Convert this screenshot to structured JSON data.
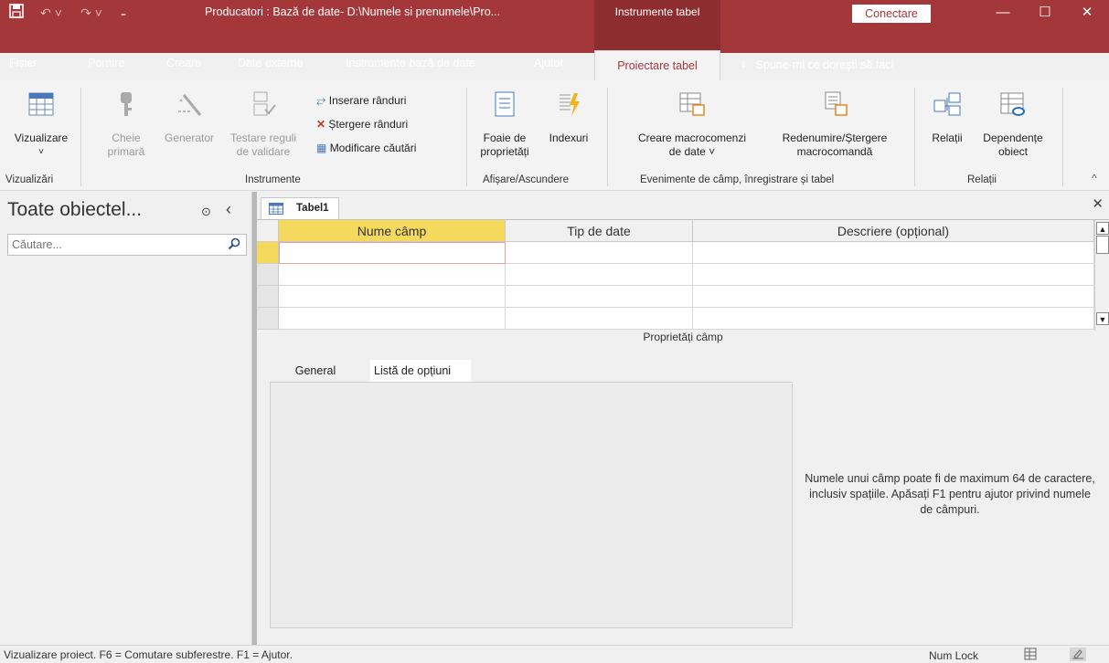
{
  "titlebar": {
    "doc_title": "Producatori : Bază de date- D:\\Numele si prenumele\\Pro...",
    "context_group": "Instrumente tabel",
    "connect": "Conectare",
    "minimize": "—",
    "maximize": "☐",
    "close": "✕"
  },
  "menu": {
    "file": "Fișier",
    "home": "Pornire",
    "create": "Creare",
    "external": "Date externe",
    "dbtools": "Instrumente bază de date",
    "help": "Ajutor",
    "design": "Proiectare tabel",
    "tell_me": "Spune-mi ce dorești să faci"
  },
  "ribbon": {
    "views": {
      "view": "Vizualizare",
      "group": "Vizualizări"
    },
    "tools": {
      "primary_key_1": "Cheie",
      "primary_key_2": "primară",
      "builder": "Generator",
      "test_rules_1": "Testare reguli",
      "test_rules_2": "de validare",
      "insert_rows": "Inserare rânduri",
      "delete_rows": "Ștergere rânduri",
      "modify_lookups": "Modificare căutări",
      "group": "Instrumente"
    },
    "showhide": {
      "property_sheet_1": "Foaie de",
      "property_sheet_2": "proprietăți",
      "indexes": "Indexuri",
      "group": "Afișare/Ascundere"
    },
    "events": {
      "create_macros_1": "Creare macrocomenzi",
      "create_macros_2": "de date ˅",
      "rename_macro_1": "Redenumire/Ștergere",
      "rename_macro_2": "macrocomandă",
      "group": "Evenimente de câmp, înregistrare și tabel"
    },
    "relationships": {
      "relationships": "Relații",
      "dependencies_1": "Dependențe",
      "dependencies_2": "obiect",
      "group": "Relații"
    }
  },
  "nav": {
    "title": "Toate obiectel...",
    "search_placeholder": "Căutare..."
  },
  "document": {
    "tab": "Tabel1",
    "columns": [
      "Nume câmp",
      "Tip de date",
      "Descriere (opțional)"
    ],
    "props_title": "Proprietăți câmp",
    "prop_tabs": [
      "General",
      "Listă de opțiuni"
    ],
    "help": "Numele unui câmp poate fi de maximum 64 de caractere, inclusiv spațiile. Apăsați F1 pentru ajutor privind numele de câmpuri."
  },
  "status": {
    "text": "Vizualizare proiect.  F6 = Comutare subferestre.  F1 = Ajutor.",
    "numlock": "Num Lock"
  },
  "colors": {
    "accent": "#a4373a",
    "context": "#8e2d30",
    "active_header": "#f5d95c"
  }
}
